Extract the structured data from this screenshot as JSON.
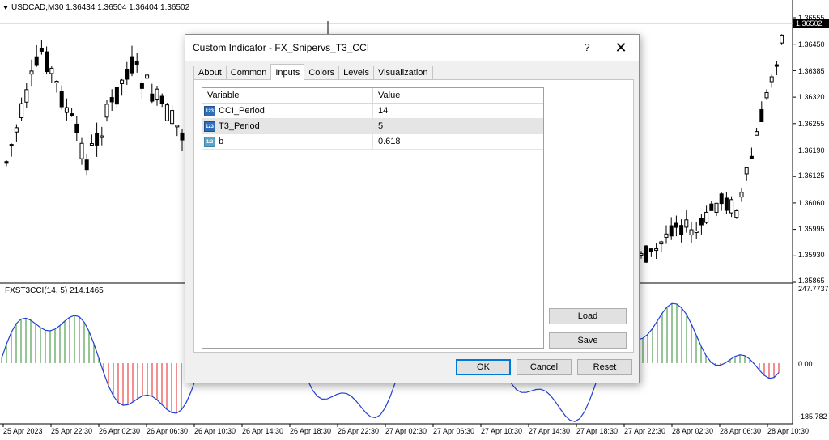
{
  "chart": {
    "title": "USDCAD,M30  1.36434 1.36504 1.36404 1.36502",
    "current_price": "1.36502",
    "price_labels": [
      "1.36555",
      "1.36450",
      "1.36385",
      "1.36320",
      "1.36255",
      "1.36190",
      "1.36125",
      "1.36060",
      "1.35995",
      "1.35930",
      "1.35865"
    ],
    "indicator_title": "FXST3CCI(14, 5) 214.1465",
    "indicator_labels": [
      "247.7737",
      "0.00",
      "-185.782"
    ],
    "time_labels": [
      "25 Apr 2023",
      "25 Apr 22:30",
      "26 Apr 02:30",
      "26 Apr 06:30",
      "26 Apr 10:30",
      "26 Apr 14:30",
      "26 Apr 18:30",
      "26 Apr 22:30",
      "27 Apr 02:30",
      "27 Apr 06:30",
      "27 Apr 10:30",
      "27 Apr 14:30",
      "27 Apr 18:30",
      "27 Apr 22:30",
      "28 Apr 02:30",
      "28 Apr 06:30",
      "28 Apr 10:30"
    ],
    "colors": {
      "bull_hist": "#2e8b2e",
      "bear_hist": "#e02020",
      "line": "#1f3fd6",
      "candle": "#000000"
    }
  },
  "dialog": {
    "title": "Custom Indicator - FX_Snipervs_T3_CCI",
    "help_label": "?",
    "close_label": "✕",
    "tabs": [
      "About",
      "Common",
      "Inputs",
      "Colors",
      "Levels",
      "Visualization"
    ],
    "active_tab": "Inputs",
    "columns": {
      "variable": "Variable",
      "value": "Value"
    },
    "rows": [
      {
        "icon": "123",
        "variable": "CCI_Period",
        "value": "14"
      },
      {
        "icon": "123",
        "variable": "T3_Period",
        "value": "5"
      },
      {
        "icon": "1/2",
        "variable": "b",
        "value": "0.618"
      }
    ],
    "load_label": "Load",
    "save_label": "Save",
    "ok_label": "OK",
    "cancel_label": "Cancel",
    "reset_label": "Reset"
  }
}
